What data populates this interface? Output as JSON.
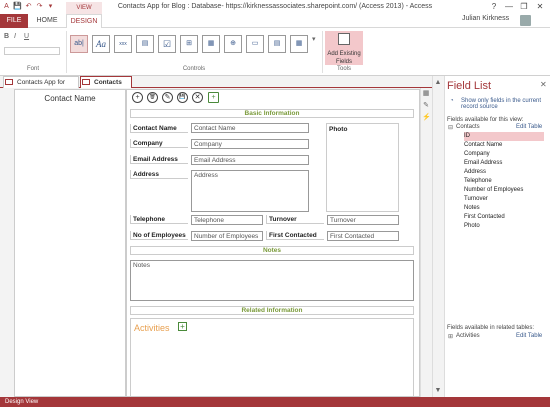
{
  "window": {
    "title": "Contacts App for Blog : Database- https://kirknessassociates.sharepoint.com/ (Access 2013) - Access",
    "help": "?",
    "minimize": "—",
    "restore": "❐",
    "close": "✕"
  },
  "quick_access": [
    "💾",
    "↶",
    "↷",
    "▾"
  ],
  "ribbon_tabs": {
    "file": "FILE",
    "home": "HOME",
    "design": "DESIGN",
    "context": "VIEW"
  },
  "user": {
    "name": "Julian Kirkness"
  },
  "ribbon": {
    "font_group": "Font",
    "controls_group": "Controls",
    "tools_group": "Tools",
    "add_existing": "Add Existing Fields",
    "controls": [
      "ab|",
      "Aa",
      "xxx",
      "▤",
      "☑",
      "⊞",
      "▦",
      "⊕",
      "▭",
      "▤",
      "▦",
      "⊞"
    ]
  },
  "doc_tabs": [
    "Contacts App for Blog",
    "Contacts List"
  ],
  "left_panel": {
    "title": "Contact Name"
  },
  "form": {
    "actions": [
      "+",
      "🗑",
      "✎",
      "💾",
      "✕",
      "+"
    ],
    "basic_info": "Basic Information",
    "contact_name_label": "Contact Name",
    "contact_name_ph": "Contact Name",
    "company_label": "Company",
    "company_ph": "Company",
    "email_label": "Email Address",
    "email_ph": "Email Address",
    "address_label": "Address",
    "address_ph": "Address",
    "photo_label": "Photo",
    "telephone_label": "Telephone",
    "telephone_ph": "Telephone",
    "turnover_label": "Turnover",
    "turnover_ph": "Turnover",
    "employees_label": "No of Employees",
    "employees_ph": "Number of Employees",
    "first_contacted_label": "First Contacted",
    "first_contacted_ph": "First Contacted",
    "notes_section": "Notes",
    "notes_ph": "Notes",
    "related_info": "Related Information",
    "activities": "Activities"
  },
  "field_list": {
    "title": "Field List",
    "show_only": "Show only fields in the current record source",
    "available": "Fields available for this view:",
    "table": "Contacts",
    "edit_table": "Edit Table",
    "fields": [
      "ID",
      "Contact Name",
      "Company",
      "Email Address",
      "Address",
      "Telephone",
      "Number of Employees",
      "Turnover",
      "Notes",
      "First Contacted",
      "Photo"
    ],
    "related": "Fields available in related tables:",
    "related_table": "Activities",
    "related_edit": "Edit Table"
  },
  "status": {
    "text": "Design View"
  },
  "colors": {
    "accent": "#a4373a",
    "field_highlight": "#f3c8cb",
    "section_text": "#7a9a3a"
  }
}
